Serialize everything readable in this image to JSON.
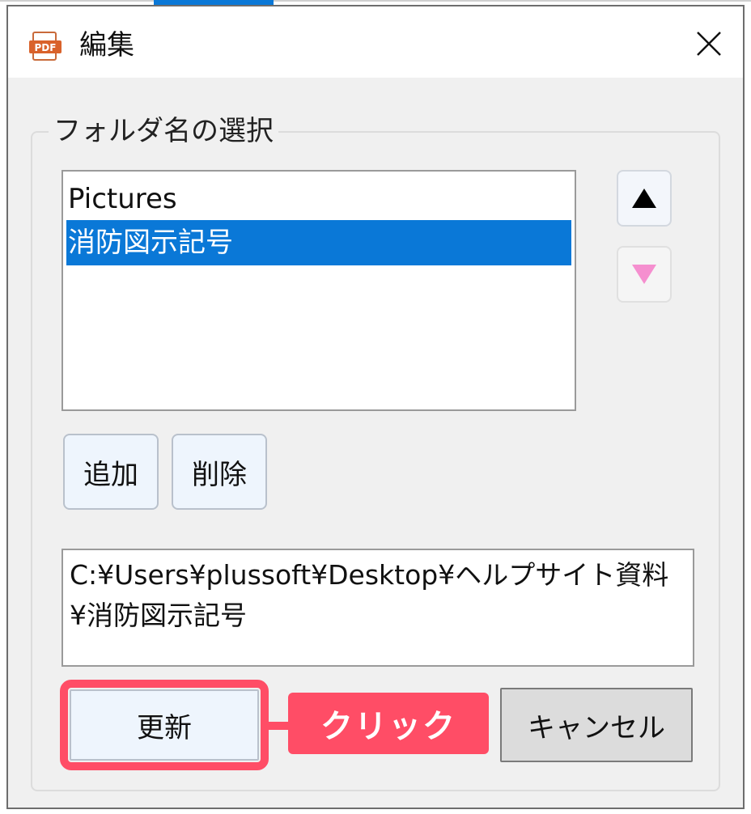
{
  "window": {
    "title": "編集",
    "app_icon_text": "PDF",
    "close_icon": "close-icon"
  },
  "folder_group": {
    "legend": "フォルダ名の選択",
    "items": [
      {
        "label": "Pictures",
        "selected": false
      },
      {
        "label": "消防図示記号",
        "selected": true
      }
    ],
    "move_up_icon": "triangle-up-icon",
    "move_down_icon": "triangle-down-icon"
  },
  "buttons": {
    "add_label": "追加",
    "delete_label": "削除",
    "update_label": "更新",
    "cancel_label": "キャンセル"
  },
  "path": {
    "value": "C:¥Users¥plussoft¥Desktop¥ヘルプサイト資料¥消防図示記号"
  },
  "annotation": {
    "callout_label": "クリック"
  },
  "colors": {
    "selection": "#0a78d7",
    "highlight": "#ff4d66",
    "down_arrow": "#f58fcf"
  }
}
